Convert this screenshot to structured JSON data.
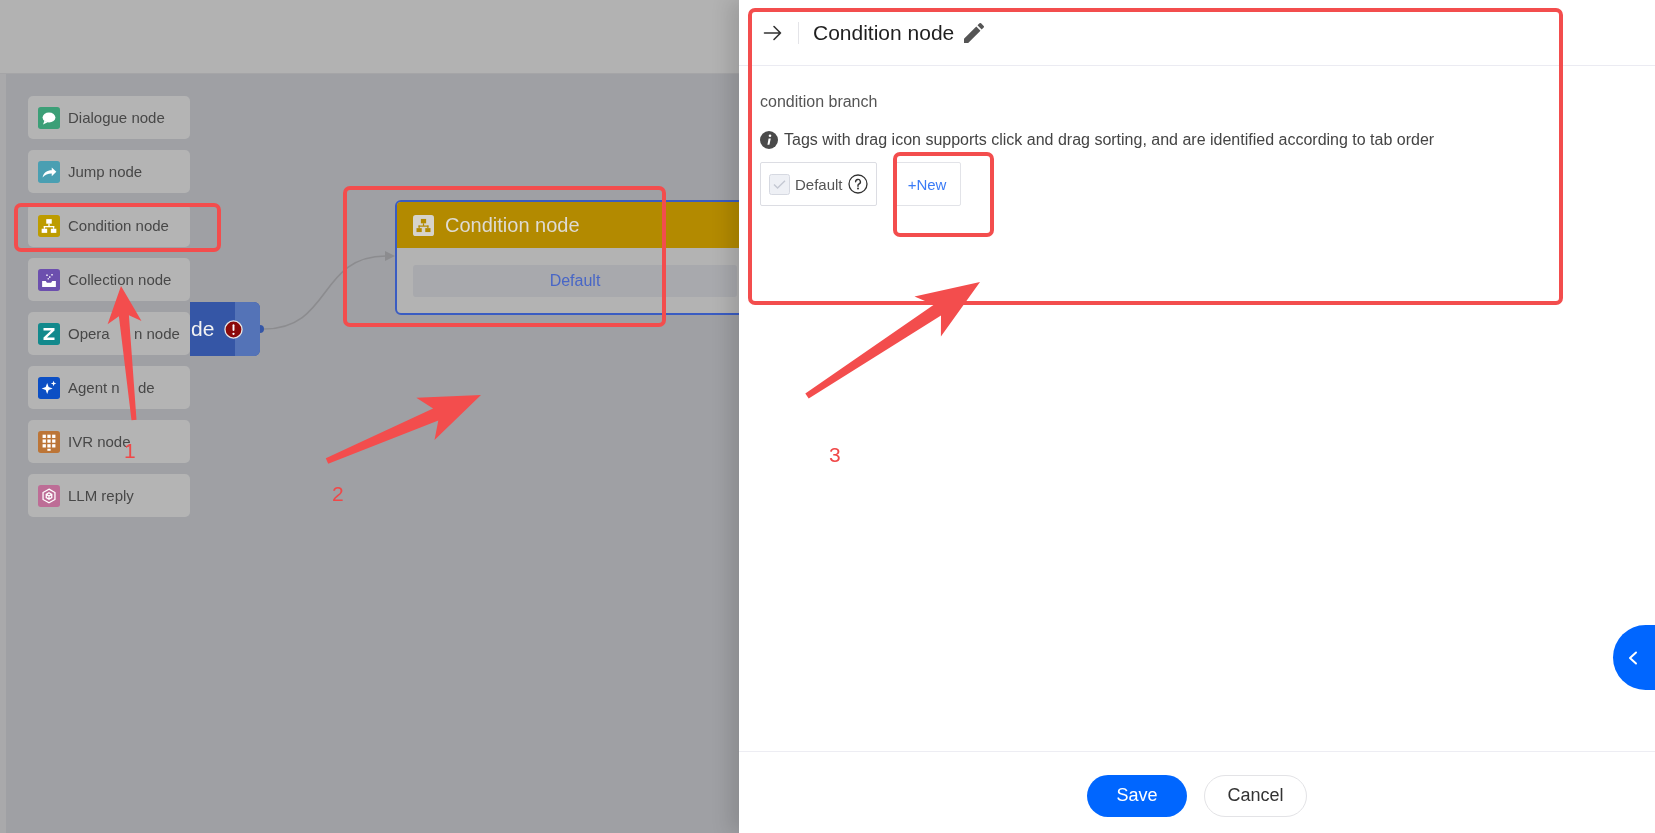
{
  "palette": {
    "items": [
      {
        "label": "Dialogue node",
        "kind": "dialogue",
        "color": "#3c9f77"
      },
      {
        "label": "Jump node",
        "kind": "jump",
        "color": "#4a9fb2"
      },
      {
        "label": "Condition node",
        "kind": "condition",
        "color": "#bd9c00"
      },
      {
        "label": "Collection node",
        "kind": "collection",
        "color": "#6c4fae"
      },
      {
        "label_parts": [
          "Opera",
          "n node"
        ],
        "kind": "operation",
        "color": "#12898c"
      },
      {
        "label_parts": [
          "Agent n",
          "de"
        ],
        "kind": "agent",
        "color": "#0c4fc4"
      },
      {
        "label": "IVR node",
        "kind": "ivr",
        "color": "#bc7537"
      },
      {
        "label": "LLM reply",
        "kind": "llm",
        "color": "#bd6d96"
      }
    ]
  },
  "canvas": {
    "start_node": {
      "label": "de",
      "error": true
    },
    "condition_node": {
      "title": "Condition node",
      "branches": [
        "Default"
      ]
    }
  },
  "drawer": {
    "title": "Condition node",
    "section_label": "condition branch",
    "info": "Tags with drag icon supports click and drag sorting, and are identified according to tab order",
    "tags": [
      {
        "label": "Default",
        "checked": true,
        "disabled": true
      }
    ],
    "new_button": "+New",
    "buttons": [
      {
        "label": "Save",
        "kind": "primary"
      },
      {
        "label": "Cancel",
        "kind": "secondary"
      }
    ]
  },
  "annotations": {
    "labels": [
      "1",
      "2",
      "3"
    ]
  }
}
